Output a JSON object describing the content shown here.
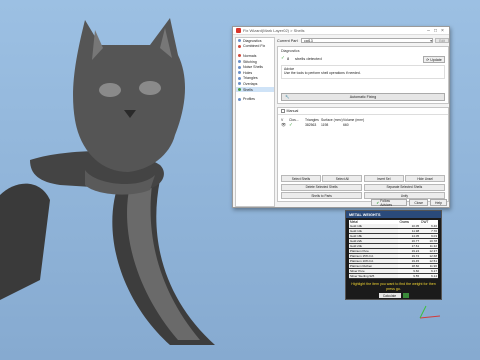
{
  "app": {
    "title": "\"Fix Wizard(Mark Layer02) > Shells\""
  },
  "dialog": {
    "title": "Fix Wizard(Mark Layer02) > Shells",
    "current_part_label": "Current Part",
    "current_part_value": "cat13",
    "edit_label": "Edit",
    "nav": [
      {
        "label": "Diagnostics",
        "color": "#6a8fc7"
      },
      {
        "label": "Combined Fix",
        "color": "#d14a3b"
      },
      {
        "label": "Normals",
        "color": "#d14a3b"
      },
      {
        "label": "Stitching",
        "color": "#6a8fc7"
      },
      {
        "label": "Noise Shells",
        "color": "#6a8fc7"
      },
      {
        "label": "Holes",
        "color": "#6a8fc7"
      },
      {
        "label": "Triangles",
        "color": "#6a8fc7"
      },
      {
        "label": "Overlaps",
        "color": "#6a8fc7"
      },
      {
        "label": "Shells",
        "color": "#4a9c4a"
      },
      {
        "label": "Profiles",
        "color": "#6a8fc7"
      }
    ],
    "diagnostics": {
      "heading": "Diagnostics",
      "count": "8",
      "message": "shells detected",
      "update_label": "Update",
      "advice_heading": "Advice",
      "advice_text": "Use the tools to perform shell operations if needed.",
      "automatic_fixing_label": "Automatic Fixing"
    },
    "shells": {
      "heading": "Manual",
      "columns": [
        "V",
        "Clos...",
        "Triangles",
        "Surface (mm²)",
        "Volume (mm³)"
      ],
      "rows": [
        {
          "triangles": "382563",
          "surface": "1198",
          "volume": "660"
        }
      ],
      "buttons": [
        "Select Shells",
        "Select All",
        "Invert Sel",
        "Hide Unsel",
        "Delete Selected Shells",
        "Separate Selected Shells",
        "Shells to Parts",
        "Unify"
      ]
    },
    "footer": {
      "follow_label": "Follow Advices",
      "close_label": "Close",
      "help_label": "Help"
    }
  },
  "metal_weights": {
    "title": "METAL WEIGHTS",
    "columns": [
      "Metal",
      "Grams",
      "DWT"
    ],
    "rows": [
      [
        "Gold 10k",
        "10.05",
        "6.46"
      ],
      [
        "Gold 14k",
        "11.98",
        "7.70"
      ],
      [
        "Gold 18k",
        "14.05",
        "9.03"
      ],
      [
        "Gold 22k",
        "16.77",
        "10.78"
      ],
      [
        "Gold 24k",
        "17.61",
        "11.32"
      ],
      [
        "Platinum Pure",
        "19.24",
        "12.37"
      ],
      [
        "Platinum 15% Ird.",
        "19.72",
        "12.68"
      ],
      [
        "Platinum 10% Ird.",
        "19.45",
        "12.51"
      ],
      [
        "Platinum Ruthen",
        "18.60",
        "11.96"
      ],
      [
        "Silver Pure",
        "9.60",
        "6.17"
      ],
      [
        "Silver Sterling 925",
        "9.55",
        "6.14"
      ]
    ],
    "hint": "Highlight the item you want to find the weight for then press go.",
    "calculate_label": "Calculate"
  }
}
